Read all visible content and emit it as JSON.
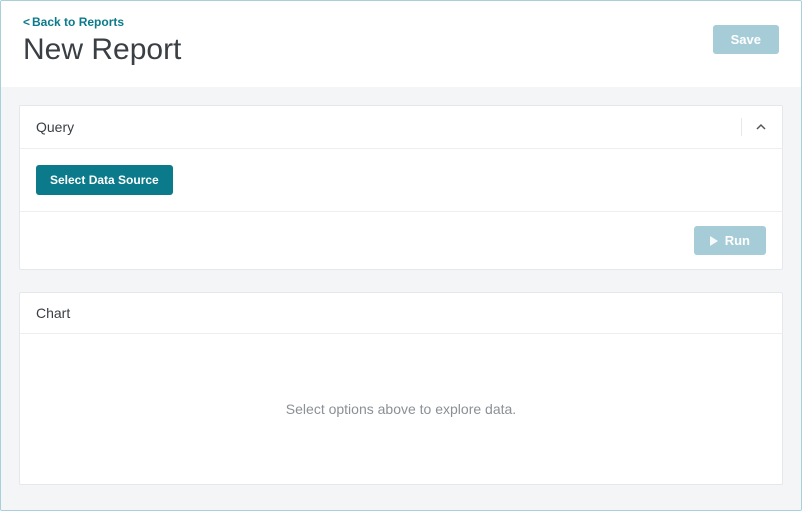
{
  "header": {
    "back_label": "Back to Reports",
    "page_title": "New Report",
    "save_label": "Save"
  },
  "query_panel": {
    "title": "Query",
    "select_datasource_label": "Select Data Source",
    "run_label": "Run"
  },
  "chart_panel": {
    "title": "Chart",
    "placeholder": "Select options above to explore data."
  },
  "colors": {
    "accent": "#0b7a8a",
    "disabled": "#a6ccd7",
    "border": "#e5e7ea",
    "body_bg": "#f4f5f6"
  }
}
